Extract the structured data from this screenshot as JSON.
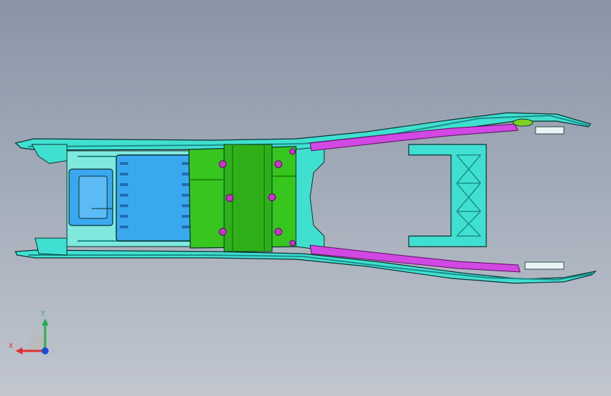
{
  "viewport": {
    "colors": {
      "background_top": "#8995a6",
      "background_bottom": "#c1c6cf",
      "frame": "#40e0d0",
      "frame_dark": "#1b8d8a",
      "outline": "#0b2f30",
      "battery": "#3aa8ef",
      "bracket": "#36c61d",
      "bracket_dark": "#1f8a0e",
      "rail": "#d148e3",
      "fastener": "#cc33cc"
    }
  },
  "triad": {
    "x_label": "X",
    "y_label": "Y",
    "z_icon": "z-axis-dot-icon"
  }
}
